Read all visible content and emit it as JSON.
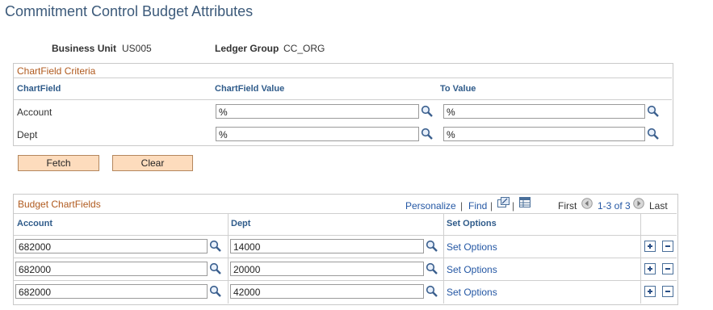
{
  "page": {
    "title": "Commitment Control Budget Attributes"
  },
  "header": {
    "business_unit_label": "Business Unit",
    "business_unit_value": "US005",
    "ledger_group_label": "Ledger Group",
    "ledger_group_value": "CC_ORG"
  },
  "criteria": {
    "title": "ChartField Criteria",
    "col_chartfield": "ChartField",
    "col_value": "ChartField Value",
    "col_to": "To Value",
    "rows": [
      {
        "label": "Account",
        "from": "%",
        "to": "%"
      },
      {
        "label": "Dept",
        "from": "%",
        "to": "%"
      }
    ]
  },
  "buttons": {
    "fetch": "Fetch",
    "clear": "Clear"
  },
  "grid": {
    "title": "Budget ChartFields",
    "personalize": "Personalize",
    "find": "Find",
    "sep": "|",
    "first": "First",
    "range": "1-3 of 3",
    "last": "Last",
    "col_account": "Account",
    "col_dept": "Dept",
    "col_options": "Set Options",
    "rows": [
      {
        "account": "682000",
        "dept": "14000",
        "options": "Set Options"
      },
      {
        "account": "682000",
        "dept": "20000",
        "options": "Set Options"
      },
      {
        "account": "682000",
        "dept": "42000",
        "options": "Set Options"
      }
    ]
  }
}
